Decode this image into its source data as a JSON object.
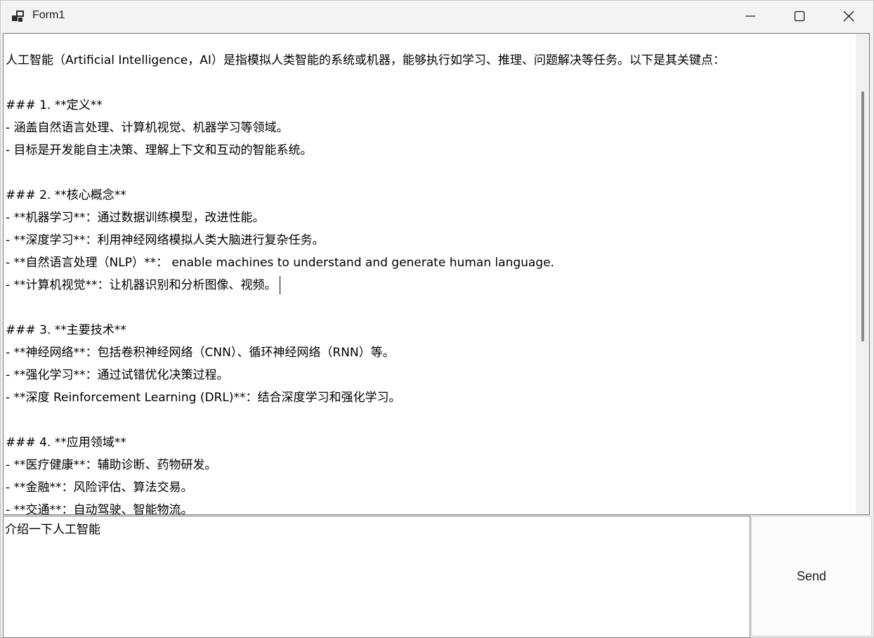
{
  "window": {
    "title": "Form1",
    "icons": {
      "app": "app-form-icon",
      "minimize": "minimize-icon",
      "maximize": "maximize-icon",
      "close": "close-icon"
    }
  },
  "output": {
    "lines": [
      "人工智能（Artificial Intelligence，AI）是指模拟人类智能的系统或机器，能够执行如学习、推理、问题解决等任务。以下是其关键点：",
      "",
      "### 1. **定义**",
      "- 涵盖自然语言处理、计算机视觉、机器学习等领域。",
      "- 目标是开发能自主决策、理解上下文和互动的智能系统。",
      "",
      "### 2. **核心概念**",
      "- **机器学习**：通过数据训练模型，改进性能。",
      "- **深度学习**：利用神经网络模拟人类大脑进行复杂任务。",
      "- **自然语言处理（NLP）**： enable machines to understand and generate human language.",
      "- **计算机视觉**：让机器识别和分析图像、视频。",
      "",
      "### 3. **主要技术**",
      "- **神经网络**：包括卷积神经网络（CNN）、循环神经网络（RNN）等。",
      "- **强化学习**：通过试错优化决策过程。",
      "- **深度 Reinforcement Learning (DRL)**：结合深度学习和强化学习。",
      "",
      "### 4. **应用领域**",
      "- **医疗健康**：辅助诊断、药物研发。",
      "- **金融**：风险评估、算法交易。",
      "- **交通**：自动驾驶、智能物流。"
    ]
  },
  "input": {
    "value": "介绍一下人工智能"
  },
  "send_button": {
    "label": "Send"
  }
}
